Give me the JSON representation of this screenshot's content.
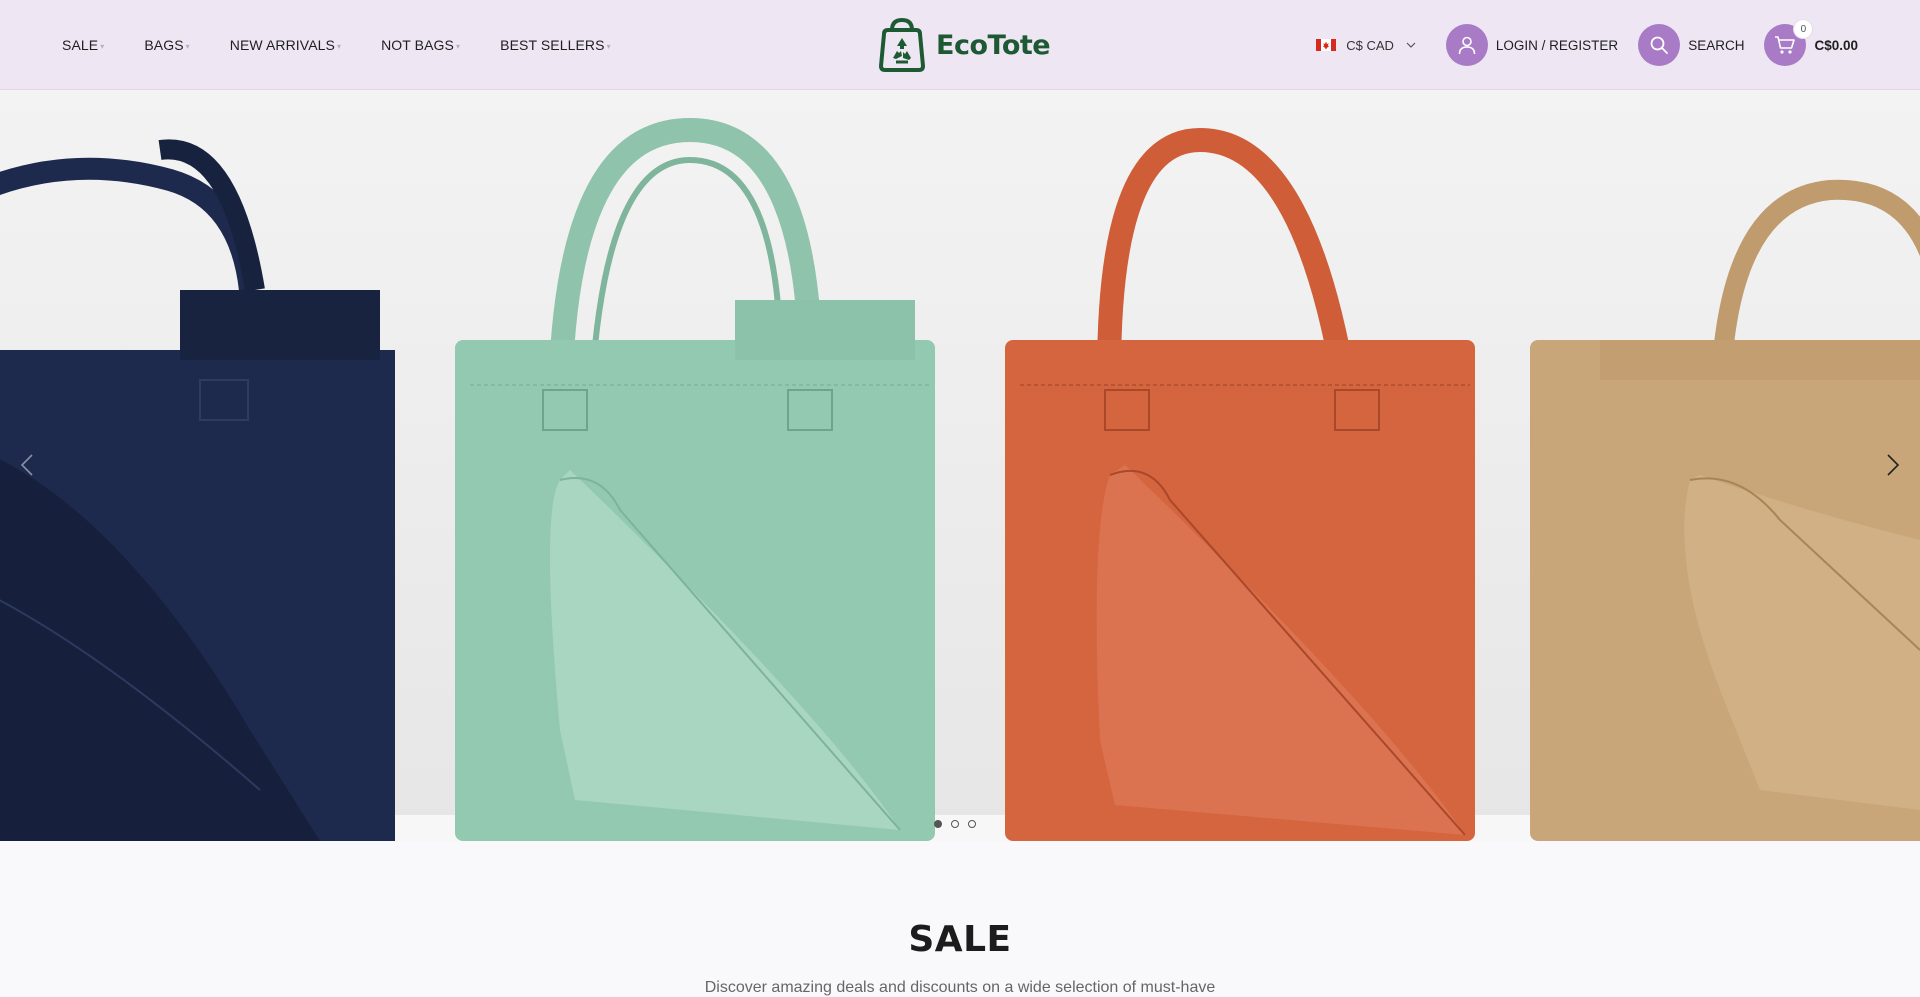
{
  "nav": {
    "items": [
      {
        "label": "SALE"
      },
      {
        "label": "BAGS"
      },
      {
        "label": "NEW ARRIVALS"
      },
      {
        "label": "NOT BAGS"
      },
      {
        "label": "BEST SELLERS"
      }
    ]
  },
  "logo": {
    "text": "EcoTote"
  },
  "currency": {
    "label": "C$ CAD",
    "flag": "canada-flag-icon"
  },
  "account": {
    "label": "LOGIN / REGISTER",
    "icon": "user-icon"
  },
  "search": {
    "label": "SEARCH",
    "icon": "search-icon"
  },
  "cart": {
    "count": "0",
    "total": "C$0.00",
    "icon": "cart-icon"
  },
  "hero": {
    "slides": 3,
    "active_slide": 1,
    "bag_colors": [
      "#1d2a4e",
      "#94c9b1",
      "#d4653f",
      "#c9a67a"
    ]
  },
  "section": {
    "title": "SALE",
    "subtitle": "Discover amazing deals and discounts on a wide selection of must-have"
  },
  "colors": {
    "header_bg": "#efe6f3",
    "accent": "#a97ac6",
    "logo_green": "#1d5a34"
  }
}
